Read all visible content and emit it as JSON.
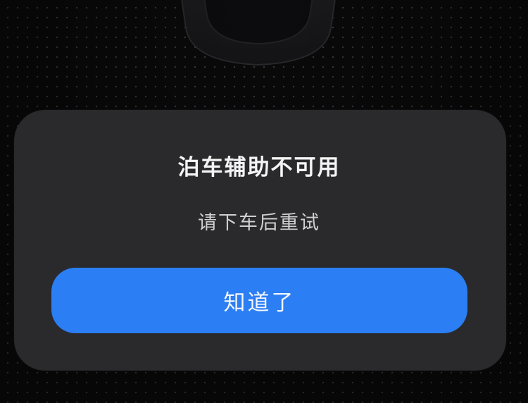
{
  "background": {
    "color": "#0a0a0b",
    "dot_color": "#3a3b3e",
    "vehicle_icon": "car-silhouette-icon"
  },
  "dialog": {
    "title": "泊车辅助不可用",
    "message": "请下车后重试",
    "confirm_label": "知道了",
    "panel_color": "#2a2a2c",
    "accent_color": "#2b7ef3"
  }
}
